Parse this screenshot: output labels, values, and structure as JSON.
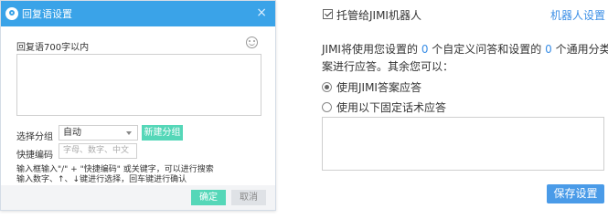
{
  "dialog": {
    "title": "回复语设置",
    "close_glyph": "×",
    "reply_label": "回复语700字以内",
    "group_label": "选择分组",
    "group_selected": "自动",
    "new_group_label": "新建分组",
    "shortcut_label": "快捷编码",
    "shortcut_placeholder": "字母、数字、中文",
    "hint_line1": "输入框输入\"/\" + \"快捷编码\" 或关键字，可以进行搜索",
    "hint_line2": "输入数字、↑、↓键进行选择，回车键进行确认",
    "confirm_label": "确定",
    "cancel_label": "取消"
  },
  "panel": {
    "hosting_label": "托管给JIMI机器人",
    "hosting_checked": true,
    "robot_settings_link": "机器人设置",
    "desc_prefix": "JIMI将使用您设置的",
    "custom_count": "0",
    "desc_middle": "个自定义问答和设置的",
    "general_count": "0",
    "desc_suffix": "个通用分类答",
    "desc_line2": "案进行应答。其余您可以：",
    "option_jimi": "使用JIMI答案应答",
    "option_fixed": "使用以下固定话术应答",
    "selected_option": "option_jimi",
    "save_label": "保存设置"
  },
  "icons": {
    "dialog_logo": "jimi-logo-icon",
    "smile": "smile-emoji-icon",
    "dropdown": "chevron-down-icon",
    "close": "close-icon"
  },
  "colors": {
    "header_blue": "#3aa3e8",
    "accent_green": "#55d7b8",
    "link_blue": "#3a8ee6",
    "save_blue": "#4a9be8"
  }
}
